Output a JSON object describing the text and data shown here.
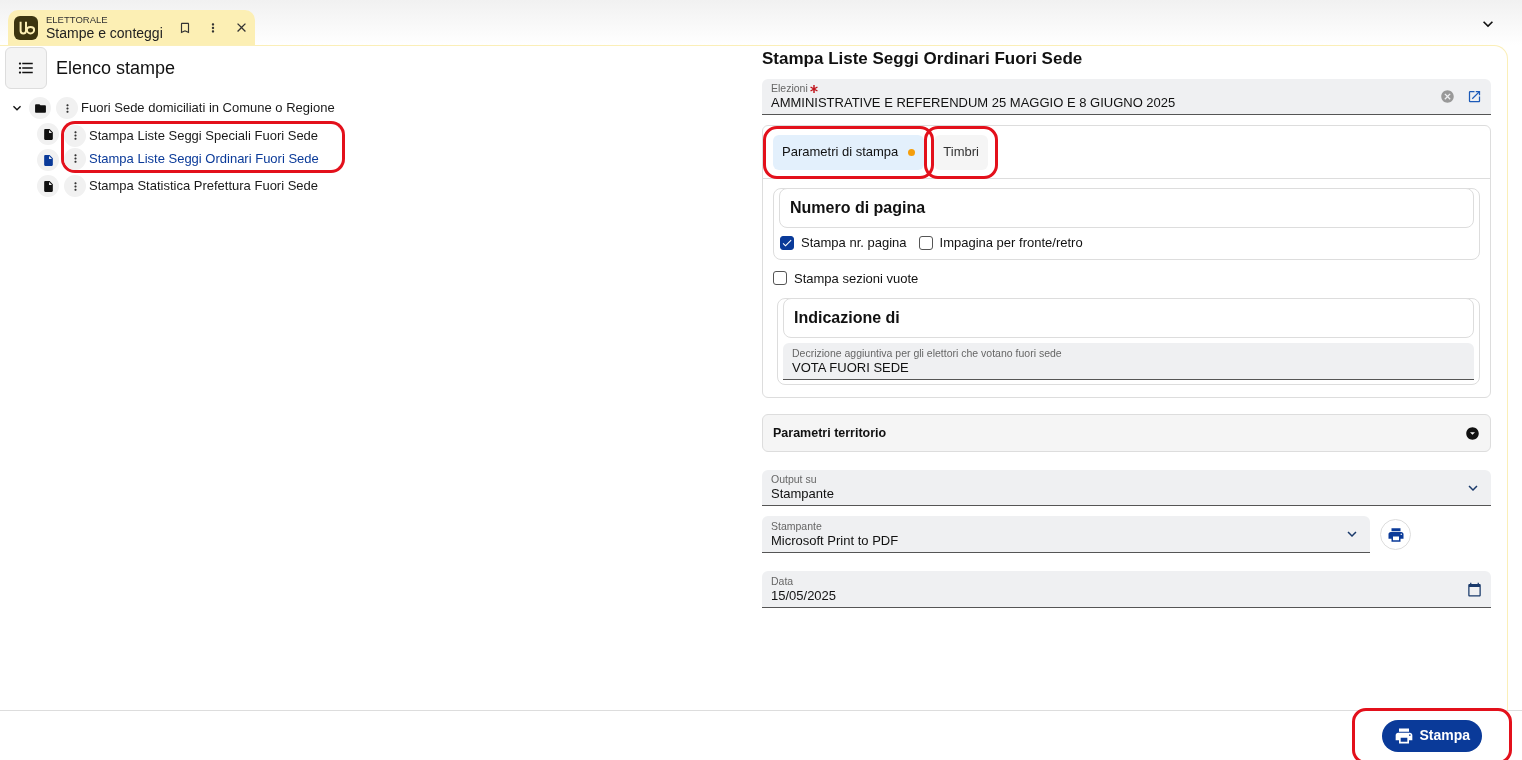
{
  "app_tab": {
    "module": "ELETTORALE",
    "title": "Stampe e conteggi"
  },
  "sidebar": {
    "title": "Elenco stampe",
    "tree": [
      {
        "label": "Fuori Sede domiciliati in Comune o Regione",
        "kind": "folder",
        "expanded": true,
        "selected": false,
        "highlighted": false,
        "children": [
          {
            "label": "Stampa Liste Seggi Speciali Fuori Sede",
            "kind": "document",
            "selected": false,
            "highlighted": true
          },
          {
            "label": "Stampa Liste Seggi Ordinari Fuori Sede",
            "kind": "document",
            "selected": true,
            "highlighted": true
          },
          {
            "label": "Stampa Statistica Prefettura Fuori Sede",
            "kind": "document",
            "selected": false,
            "highlighted": false
          }
        ]
      }
    ]
  },
  "form": {
    "title": "Stampa Liste Seggi Ordinari Fuori Sede",
    "elezioni": {
      "label": "Elezioni",
      "required": true,
      "value": "AMMINISTRATIVE E REFERENDUM 25 MAGGIO E 8 GIUGNO 2025"
    },
    "tabs": [
      {
        "label": "Parametri di stampa",
        "selected": true,
        "modified": true,
        "highlighted": true
      },
      {
        "label": "Timbri",
        "selected": false,
        "modified": false,
        "highlighted": true
      }
    ],
    "page_number": {
      "title": "Numero di pagina",
      "options": [
        {
          "label": "Stampa nr. pagina",
          "checked": true
        },
        {
          "label": "Impagina per fronte/retro",
          "checked": false
        }
      ]
    },
    "empty_sections": {
      "label": "Stampa sezioni vuote",
      "checked": false
    },
    "indication": {
      "title": "Indicazione di",
      "field": {
        "label": "Decrizione aggiuntiva per gli elettori che votano fuori sede",
        "value": "VOTA FUORI SEDE"
      }
    },
    "territory": {
      "title": "Parametri territorio",
      "expanded": false
    },
    "output": {
      "label": "Output su",
      "value": "Stampante"
    },
    "printer": {
      "label": "Stampante",
      "value": "Microsoft Print to PDF"
    },
    "date": {
      "label": "Data",
      "value": "15/05/2025"
    }
  },
  "footer": {
    "print_button": {
      "label": "Stampa",
      "highlighted": true
    }
  }
}
